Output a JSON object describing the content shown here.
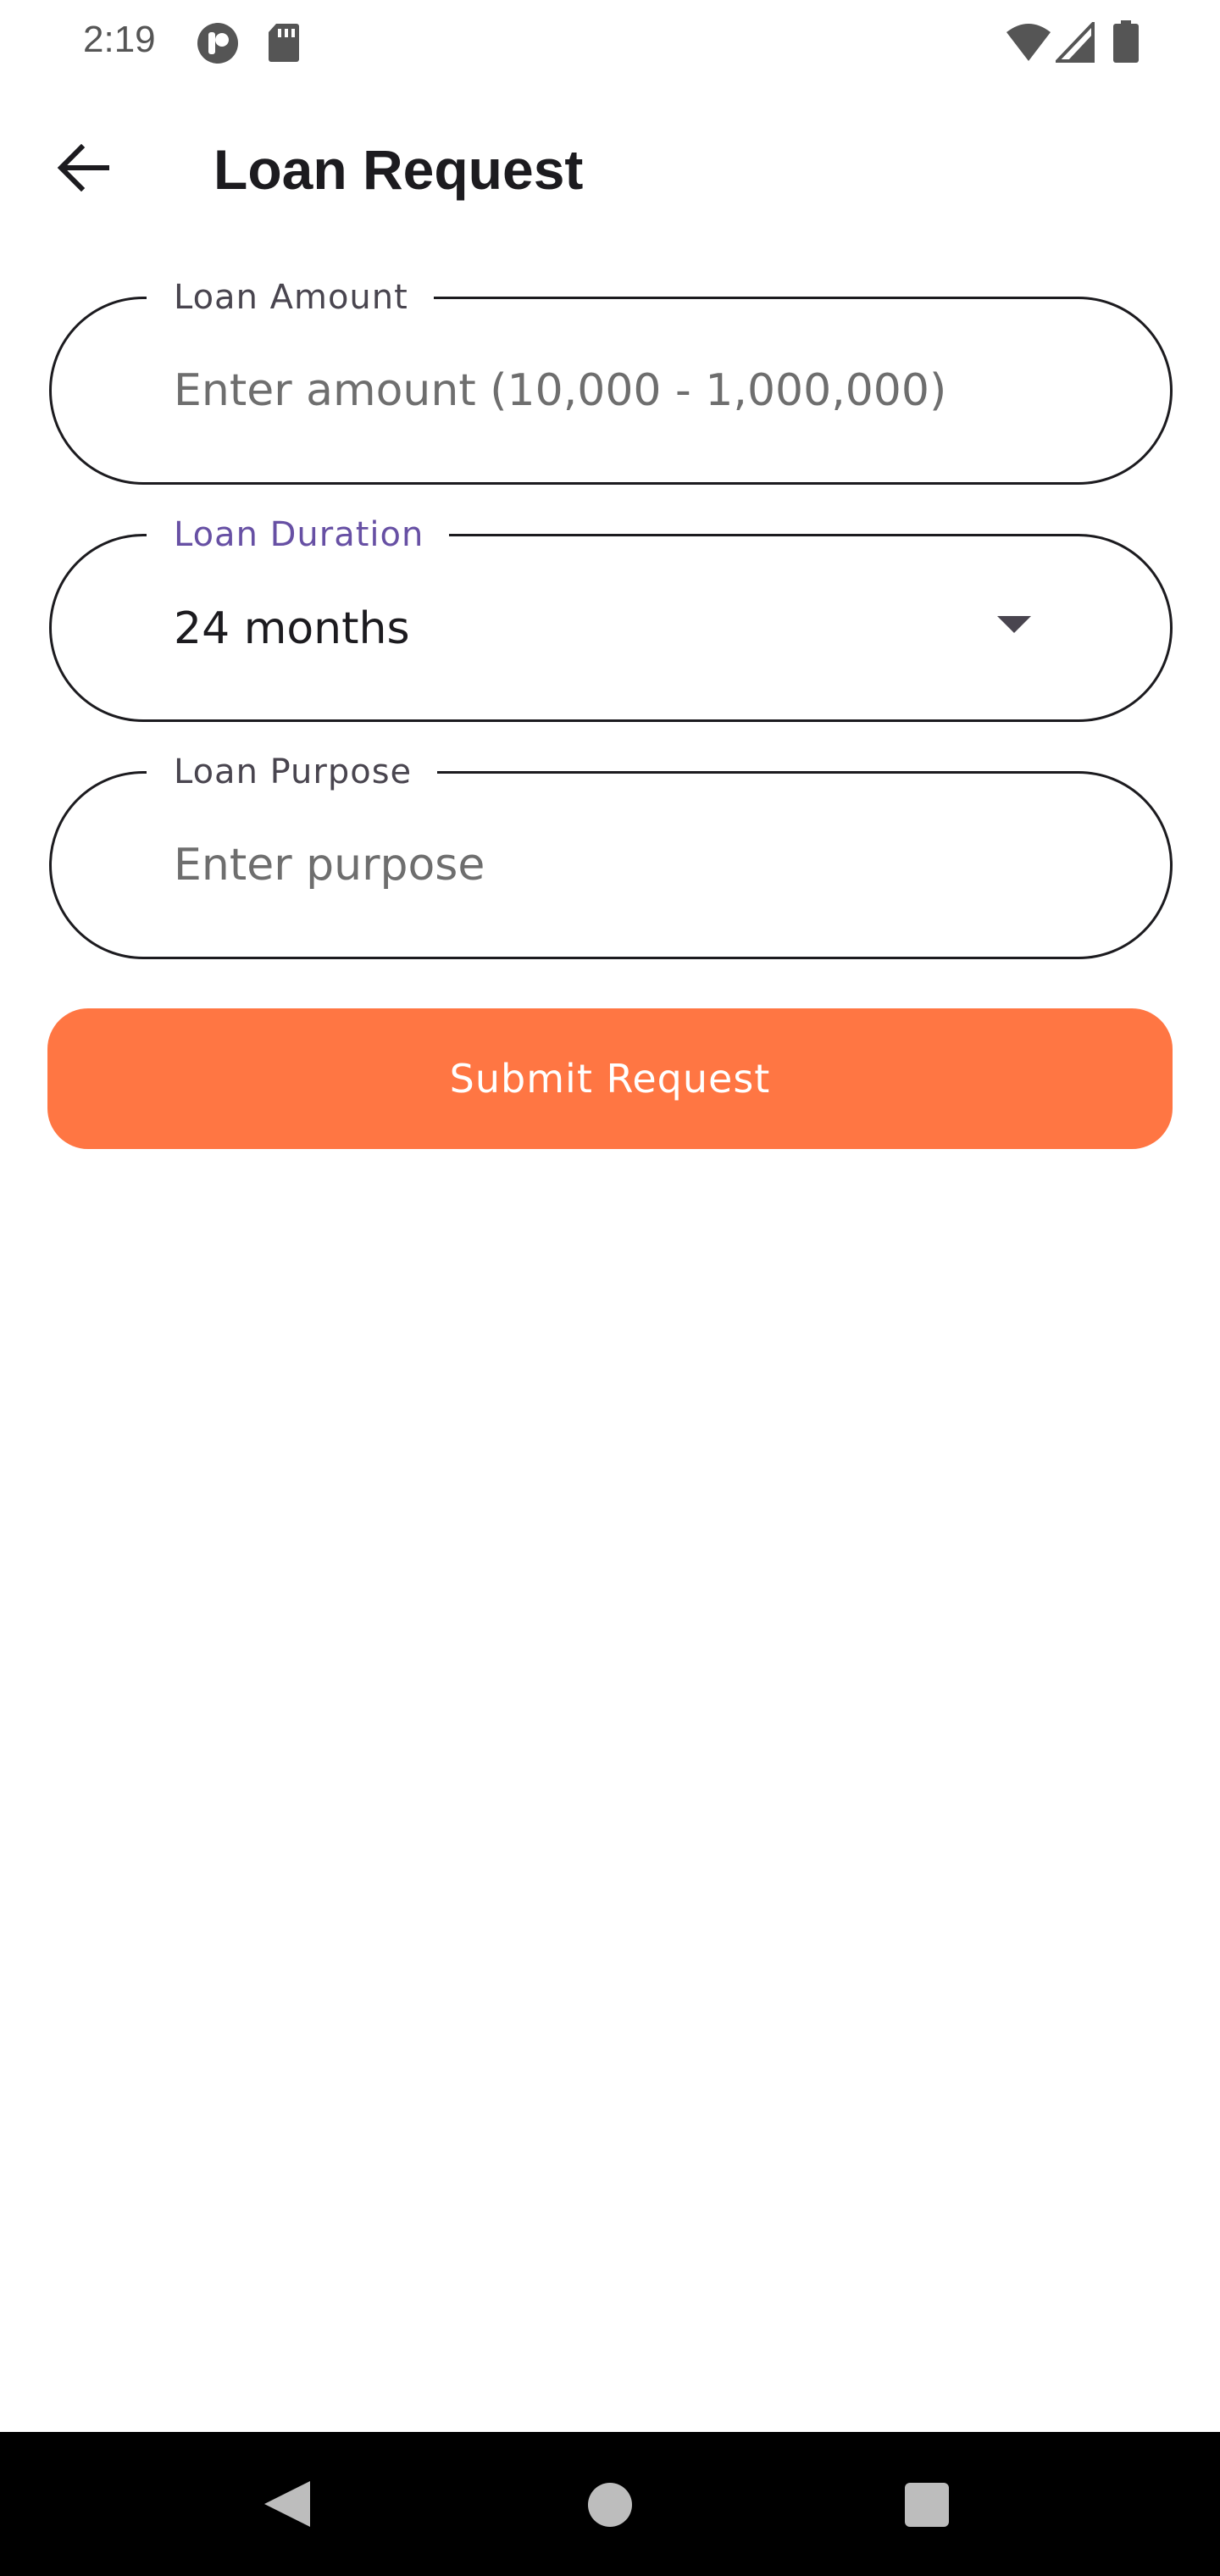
{
  "status_bar": {
    "time": "2:19",
    "icons": [
      "app-notification-icon",
      "sd-card-icon",
      "wifi-icon",
      "cell-signal-icon",
      "battery-icon"
    ]
  },
  "app_bar": {
    "back_icon": "arrow-back-icon",
    "title": "Loan Request"
  },
  "form": {
    "loan_amount": {
      "label": "Loan Amount",
      "placeholder": "Enter amount (10,000 - 1,000,000)",
      "value": ""
    },
    "loan_duration": {
      "label": "Loan Duration",
      "selected": "24 months",
      "icon": "dropdown-arrow-icon"
    },
    "loan_purpose": {
      "label": "Loan Purpose",
      "placeholder": "Enter purpose",
      "value": ""
    },
    "submit_label": "Submit Request"
  },
  "nav_bar": {
    "icons": [
      "nav-back-icon",
      "nav-home-icon",
      "nav-recents-icon"
    ]
  },
  "colors": {
    "accent": "#ff7643",
    "focused_label": "#6750a4",
    "text": "#1c1b1f",
    "nav_background": "#000000"
  }
}
